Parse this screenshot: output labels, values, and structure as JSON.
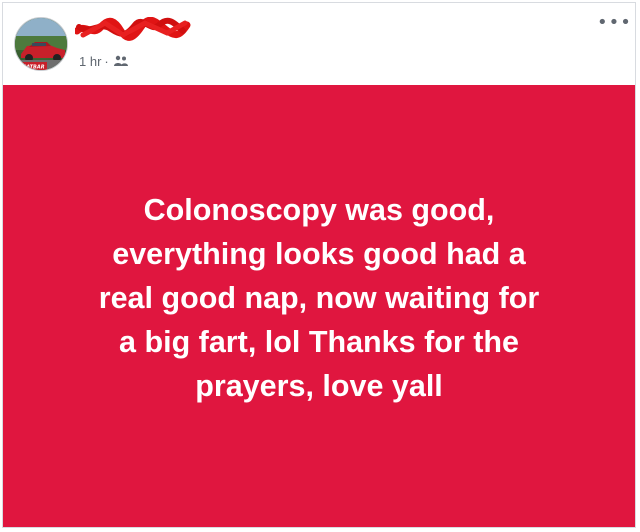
{
  "post": {
    "timestamp": "1 hr",
    "separator": "·",
    "audience_icon": "friends-icon",
    "more_label": "•••",
    "status_text": "Colonoscopy was good,\neverything looks good had a\nreal good nap, now waiting for\na big fart, lol Thanks for the\nprayers, love yall",
    "background_color": "#e0163f",
    "text_color": "#ffffff"
  }
}
